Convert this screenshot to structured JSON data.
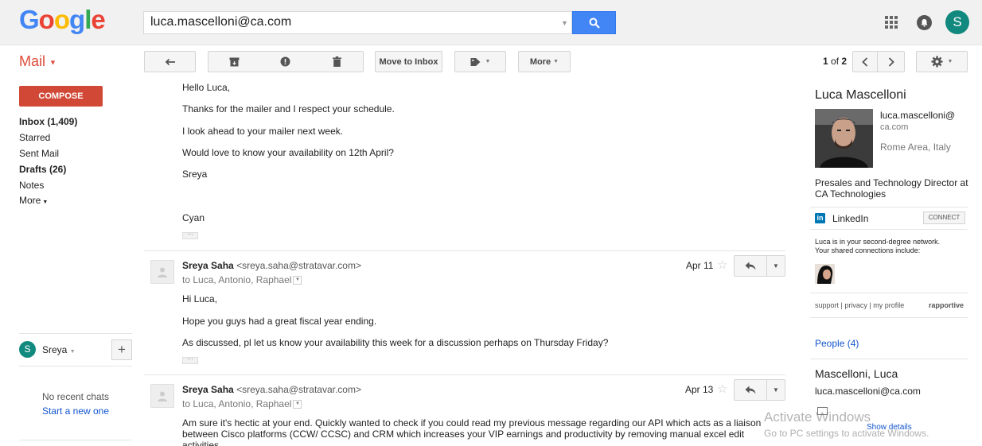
{
  "header": {
    "logo_text": "Google",
    "search_value": "luca.mascelloni@ca.com",
    "account_initial": "S"
  },
  "toolbar": {
    "mail_label": "Mail",
    "move_to_inbox": "Move to Inbox",
    "more_label": "More",
    "pager_prefix": "1",
    "pager_of": "of",
    "pager_total": "2"
  },
  "nav": {
    "compose": "COMPOSE",
    "items": [
      {
        "label": "Inbox (1,409)",
        "bold": true
      },
      {
        "label": "Starred",
        "bold": false
      },
      {
        "label": "Sent Mail",
        "bold": false
      },
      {
        "label": "Drafts (26)",
        "bold": true
      },
      {
        "label": "Notes",
        "bold": false
      },
      {
        "label": "More",
        "bold": false
      }
    ]
  },
  "chat": {
    "user_initial": "S",
    "user_name": "Sreya",
    "no_chats": "No recent chats",
    "start_new": "Start a new one"
  },
  "thread": {
    "first_message_lines": [
      "Hello Luca,",
      "Thanks for the mailer and I respect your schedule.",
      "I look ahead to your mailer next week.",
      "Would love to know your availability on 12th April?",
      "Sreya",
      "Cyan"
    ],
    "messages": [
      {
        "sender": "Sreya Saha",
        "email": "<sreya.saha@stratavar.com>",
        "to": "to Luca, Antonio, Raphael",
        "date": "Apr 11",
        "lines": [
          "Hi Luca,",
          "Hope you guys had a great fiscal year ending.",
          "As discussed, pl let us know your availability this week for a discussion perhaps on Thursday Friday?"
        ]
      },
      {
        "sender": "Sreya Saha",
        "email": "<sreya.saha@stratavar.com>",
        "to": "to Luca, Antonio, Raphael",
        "date": "Apr 13",
        "lines": [
          "Am sure it's hectic at your end. Quickly wanted to check if you could read my previous message regarding our API which acts as a liaison",
          "between Cisco platforms (CCW/ CCSC) and CRM which increases your VIP earnings and productivity by removing manual excel edit",
          "activities"
        ]
      }
    ]
  },
  "profile": {
    "name": "Luca Mascelloni",
    "email_user": "luca.mascelloni@",
    "email_domain": "ca.com",
    "location": "Rome Area, Italy",
    "title": "Presales and Technology Director at CA Technologies",
    "linkedin_label": "LinkedIn",
    "connect_label": "CONNECT",
    "network_line1": "Luca is in your second-degree network.",
    "network_line2": "Your shared connections include:",
    "footer_links": "support | privacy | my profile",
    "footer_brand": "rapportive",
    "people_label": "People (4)",
    "contact_name": "Mascelloni, Luca",
    "contact_email": "luca.mascelloni@ca.com"
  },
  "watermark": {
    "title": "Activate Windows",
    "subtitle": "Go to PC settings to activate Windows.",
    "link": "Show details"
  },
  "colors": {
    "accent_red": "#dd4b39",
    "compose_red": "#d14836",
    "search_blue": "#4285f4",
    "avatar_teal": "#12897e",
    "link_blue": "#1155cc",
    "linkedin_blue": "#0077b5"
  }
}
